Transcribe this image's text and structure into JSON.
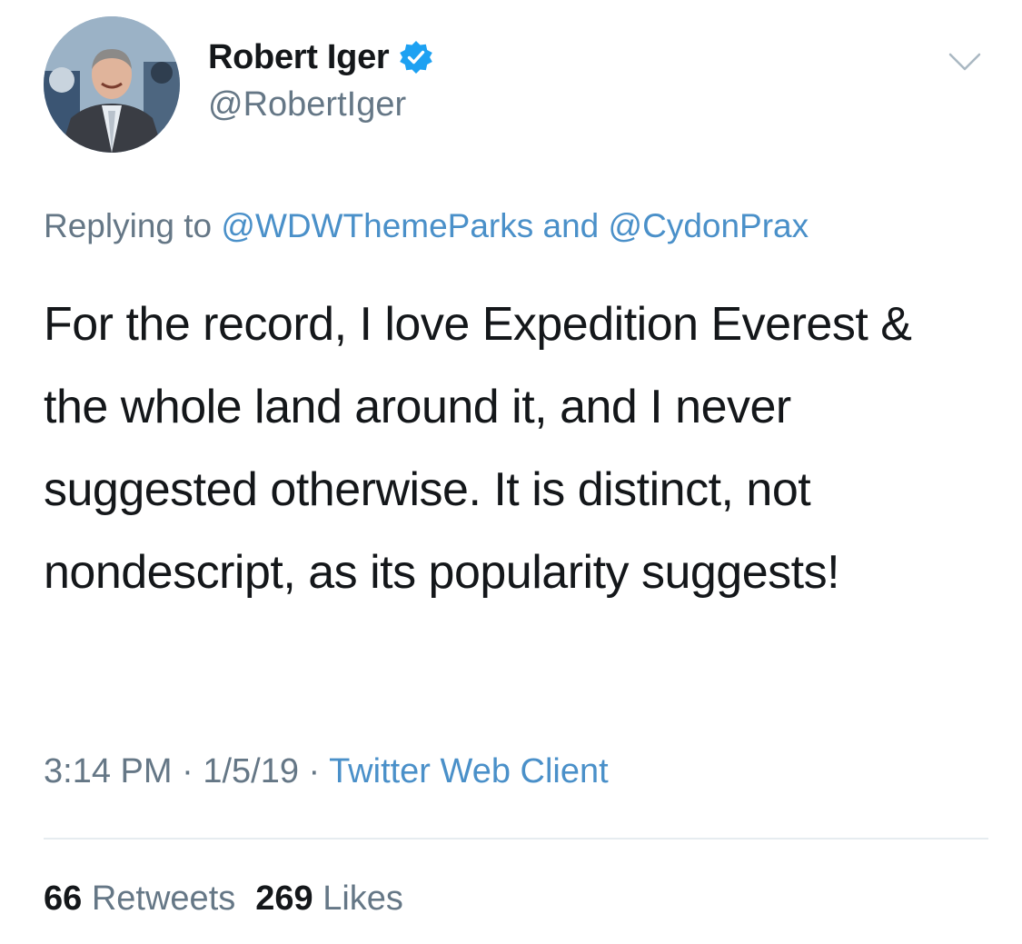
{
  "author": {
    "display_name": "Robert Iger",
    "handle": "@RobertIger",
    "verified": true
  },
  "reply": {
    "prefix": "Replying to",
    "mention_1": "@WDWThemeParks",
    "joiner": "and",
    "mention_2": "@CydonPrax"
  },
  "tweet": {
    "text": "For the record, I love Expedition Everest & the whole land around it, and I never suggested otherwise. It is distinct, not nondescript, as its popularity suggests!"
  },
  "meta": {
    "time": "3:14 PM",
    "separator": "·",
    "date": "1/5/19",
    "source": "Twitter Web Client"
  },
  "stats": {
    "retweets_count": "66",
    "retweets_label": "Retweets",
    "likes_count": "269",
    "likes_label": "Likes"
  },
  "colors": {
    "link": "#4a90c9",
    "secondary_text": "#657786",
    "primary_text": "#14171a",
    "verified_badge": "#1da1f2",
    "divider": "#e6ecf0"
  },
  "icons": {
    "verified": "verified-badge-icon",
    "more": "chevron-down-icon"
  }
}
